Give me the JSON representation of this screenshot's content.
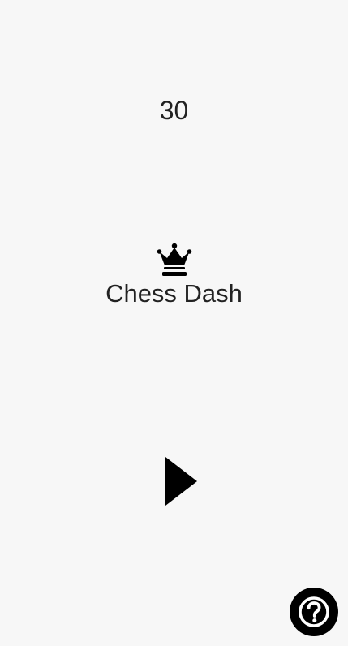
{
  "game": {
    "score": "30",
    "title": "Chess Dash"
  },
  "icons": {
    "logo": "crown-icon",
    "play": "play-icon",
    "help": "help-circle-icon"
  },
  "colors": {
    "background": "#f7f7f7",
    "text": "#222222",
    "icon": "#000000"
  }
}
